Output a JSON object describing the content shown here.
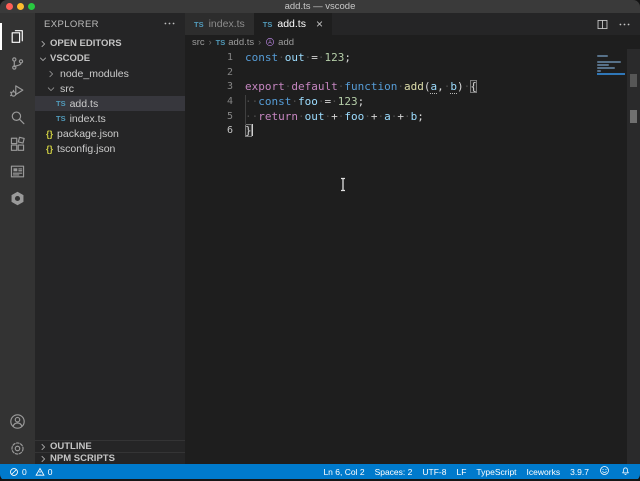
{
  "window": {
    "title": "add.ts — vscode"
  },
  "activity_bar": {
    "top": [
      {
        "icon": "explorer",
        "active": true
      },
      {
        "icon": "source-control",
        "active": false
      },
      {
        "icon": "run-debug",
        "active": false
      },
      {
        "icon": "search",
        "active": false
      },
      {
        "icon": "extensions",
        "active": false
      },
      {
        "icon": "iceworks",
        "active": false
      },
      {
        "icon": "hexagon-tool",
        "active": false
      }
    ],
    "bottom": [
      {
        "icon": "account",
        "active": false
      },
      {
        "icon": "settings-gear",
        "active": false
      }
    ]
  },
  "sidebar": {
    "title": "EXPLORER",
    "open_editors_label": "OPEN EDITORS",
    "workspace_label": "VSCODE",
    "ts_icon_text": "TS",
    "json_icon_text": "{}",
    "tree": [
      {
        "label": "node_modules",
        "kind": "folder",
        "expanded": false,
        "indent": 1,
        "selected": false
      },
      {
        "label": "src",
        "kind": "folder",
        "expanded": true,
        "indent": 1,
        "selected": false
      },
      {
        "label": "add.ts",
        "kind": "ts",
        "indent": 2,
        "selected": true
      },
      {
        "label": "index.ts",
        "kind": "ts",
        "indent": 2,
        "selected": false
      },
      {
        "label": "package.json",
        "kind": "json",
        "indent": 1,
        "selected": false
      },
      {
        "label": "tsconfig.json",
        "kind": "json",
        "indent": 1,
        "selected": false
      }
    ],
    "bottom_sections": [
      "OUTLINE",
      "NPM SCRIPTS"
    ]
  },
  "editor": {
    "tabs": [
      {
        "label": "index.ts",
        "icon": "TS",
        "active": false
      },
      {
        "label": "add.ts",
        "icon": "TS",
        "active": true,
        "close_glyph": "×"
      }
    ],
    "breadcrumb": [
      {
        "label": "src"
      },
      {
        "label": "add.ts",
        "icon": "ts"
      },
      {
        "label": "add",
        "icon": "symbol-method"
      }
    ],
    "code": {
      "language": "typescript",
      "lines": [
        {
          "num": "1",
          "active": false,
          "tokens": [
            [
              "kw",
              "const"
            ],
            [
              "ws",
              "·"
            ],
            [
              "var",
              "out"
            ],
            [
              "ws",
              "·"
            ],
            [
              "pun",
              "="
            ],
            [
              "ws",
              "·"
            ],
            [
              "num",
              "123"
            ],
            [
              "pun",
              ";"
            ]
          ]
        },
        {
          "num": "2",
          "active": false,
          "tokens": []
        },
        {
          "num": "3",
          "active": false,
          "tokens": [
            [
              "ctl",
              "export"
            ],
            [
              "ws",
              "·"
            ],
            [
              "ctl",
              "default"
            ],
            [
              "ws",
              "·"
            ],
            [
              "kw",
              "function"
            ],
            [
              "ws",
              "·"
            ],
            [
              "fn",
              "add"
            ],
            [
              "pun",
              "("
            ],
            [
              "param",
              "a"
            ],
            [
              "pun",
              ","
            ],
            [
              "ws",
              "·"
            ],
            [
              "param",
              "b"
            ],
            [
              "pun",
              ")"
            ],
            [
              "ws",
              "·"
            ],
            [
              "brk",
              "{"
            ]
          ]
        },
        {
          "num": "4",
          "active": false,
          "tokens": [
            [
              "ws",
              "··"
            ],
            [
              "kw",
              "const"
            ],
            [
              "ws",
              "·"
            ],
            [
              "var",
              "foo"
            ],
            [
              "ws",
              "·"
            ],
            [
              "pun",
              "="
            ],
            [
              "ws",
              "·"
            ],
            [
              "num",
              "123"
            ],
            [
              "pun",
              ";"
            ]
          ]
        },
        {
          "num": "5",
          "active": false,
          "tokens": [
            [
              "ws",
              "··"
            ],
            [
              "ctl",
              "return"
            ],
            [
              "ws",
              "·"
            ],
            [
              "var",
              "out"
            ],
            [
              "ws",
              "·"
            ],
            [
              "pun",
              "+"
            ],
            [
              "ws",
              "·"
            ],
            [
              "var",
              "foo"
            ],
            [
              "ws",
              "·"
            ],
            [
              "pun",
              "+"
            ],
            [
              "ws",
              "·"
            ],
            [
              "var",
              "a"
            ],
            [
              "ws",
              "·"
            ],
            [
              "pun",
              "+"
            ],
            [
              "ws",
              "·"
            ],
            [
              "var",
              "b"
            ],
            [
              "pun",
              ";"
            ]
          ]
        },
        {
          "num": "6",
          "active": true,
          "tokens": [
            [
              "brk",
              "}"
            ],
            [
              "cursor",
              ""
            ]
          ]
        }
      ]
    }
  },
  "status_bar": {
    "problems": {
      "errors": "0",
      "warnings": "0"
    },
    "right_items": [
      "Ln 6, Col 2",
      "Spaces: 2",
      "UTF-8",
      "LF",
      "TypeScript",
      "Iceworks",
      "3.9.7"
    ]
  },
  "colors": {
    "titlebar": "#3a3a3a",
    "activity": "#333333",
    "sidebar": "#252526",
    "editor": "#1e1e1e",
    "tabbar": "#252526",
    "tab_inactive": "#2d2d2d",
    "status": "#007acc",
    "selection": "#37373d",
    "traffic_red": "#ff5f57",
    "traffic_yellow": "#febc2e",
    "traffic_green": "#28c840",
    "ts": "#519aba",
    "json": "#cbcb41",
    "method": "#b180d7",
    "kw": "#569cd6",
    "ctl": "#c586c0",
    "vr": "#9cdcfe",
    "fn": "#dcdcaa",
    "num": "#b5cea8",
    "pun": "#d4d4d4",
    "ws": "#4b4b4b",
    "linenum": "#858585"
  }
}
